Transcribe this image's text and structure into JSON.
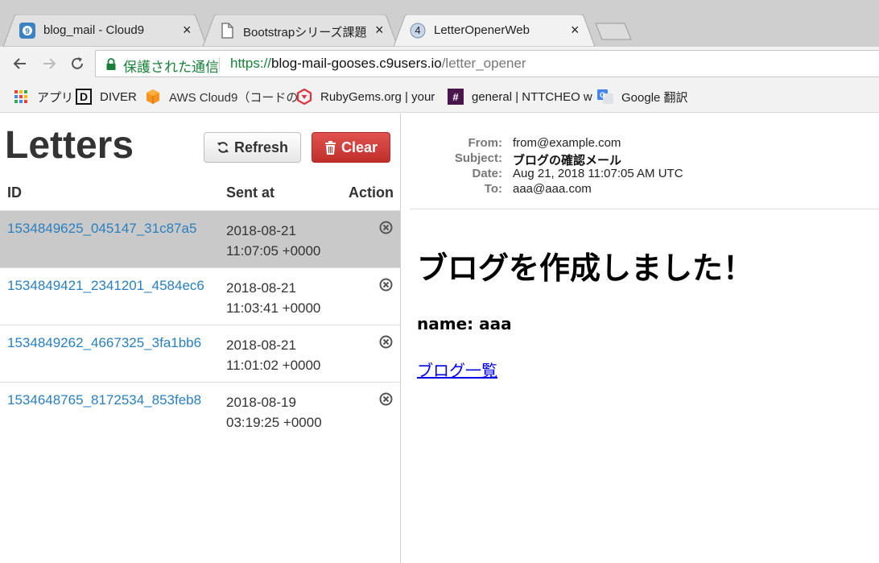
{
  "tabs": [
    {
      "title": "blog_mail - Cloud9",
      "icon": "cloud9-icon",
      "close": "×"
    },
    {
      "title": "Bootstrapシリーズ課題",
      "icon": "document-icon",
      "close": "×"
    },
    {
      "title": "LetterOpenerWeb",
      "icon": "badge-4-icon",
      "badge": "4",
      "close": "×"
    }
  ],
  "address_bar": {
    "secure_label": "保護された通信",
    "url_protocol": "https://",
    "url_host": "blog-mail-gooses.c9users.io",
    "url_path": "/letter_opener"
  },
  "bookmarks": [
    {
      "label": "アプリ",
      "icon": "apps-grid-icon"
    },
    {
      "label": "DIVER",
      "icon": "diver-d-icon",
      "glyph": "D"
    },
    {
      "label": "AWS Cloud9（コードの",
      "icon": "aws-cube-icon"
    },
    {
      "label": "RubyGems.org | your",
      "icon": "rubygems-icon"
    },
    {
      "label": "general | NTTCHEO w",
      "icon": "slack-hash-icon",
      "glyph": "#"
    },
    {
      "label": "Google 翻訳",
      "icon": "google-translate-icon"
    }
  ],
  "letters": {
    "title": "Letters",
    "refresh_label": "Refresh",
    "clear_label": "Clear",
    "columns": {
      "id": "ID",
      "sent_at": "Sent at",
      "action": "Action"
    },
    "rows": [
      {
        "id": "1534849625_045147_31c87a5",
        "date": "2018-08-21",
        "time": "11:07:05 +0000",
        "selected": true
      },
      {
        "id": "1534849421_2341201_4584ec6",
        "date": "2018-08-21",
        "time": "11:03:41 +0000",
        "selected": false
      },
      {
        "id": "1534849262_4667325_3fa1bb6",
        "date": "2018-08-21",
        "time": "11:01:02 +0000",
        "selected": false
      },
      {
        "id": "1534648765_8172534_853feb8",
        "date": "2018-08-19",
        "time": "03:19:25 +0000",
        "selected": false
      }
    ]
  },
  "message": {
    "headers": [
      {
        "key": "From:",
        "value": "from@example.com",
        "bold": false
      },
      {
        "key": "Subject:",
        "value": "ブログの確認メール",
        "bold": true
      },
      {
        "key": "Date:",
        "value": "Aug 21, 2018 11:07:05 AM UTC",
        "bold": false
      },
      {
        "key": "To:",
        "value": "aaa@aaa.com",
        "bold": false
      }
    ],
    "heading": "ブログを作成しました！",
    "name_line": "name: aaa",
    "link_text": "ブログ一覧"
  },
  "colors": {
    "link": "#2a7fbf",
    "danger": "#d43f3a",
    "secure_green": "#188038",
    "selected_row": "#c9c9c9"
  }
}
